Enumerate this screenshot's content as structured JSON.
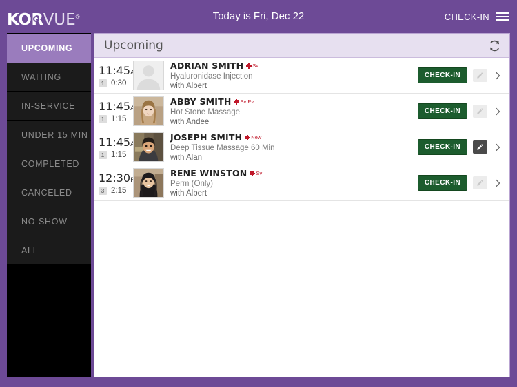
{
  "header": {
    "logo_main": "KOR",
    "logo_sub": "VUE",
    "logo_reg": "®",
    "today_text": "Today is Fri, Dec 22",
    "checkin_label": "CHECK-IN",
    "menu_icon": "hamburger-menu-icon"
  },
  "sidebar": {
    "items": [
      {
        "label": "UPCOMING",
        "active": true
      },
      {
        "label": "WAITING",
        "active": false
      },
      {
        "label": "IN-SERVICE",
        "active": false
      },
      {
        "label": "UNDER 15 MIN",
        "active": false
      },
      {
        "label": "COMPLETED",
        "active": false
      },
      {
        "label": "CANCELED",
        "active": false
      },
      {
        "label": "NO-SHOW",
        "active": false
      },
      {
        "label": "ALL",
        "active": false
      }
    ]
  },
  "content": {
    "title": "Upcoming",
    "refresh_icon": "refresh-icon",
    "appointments": [
      {
        "time": "11:45",
        "meridiem": "AM",
        "count": "1",
        "duration": "0:30",
        "name": "ADRIAN SMITH",
        "tags": "Sv",
        "service": "Hyaluronidase Injection",
        "provider": "with Albert",
        "checkin_label": "CHECK-IN",
        "edit_enabled": false,
        "avatar": "placeholder-silhouette"
      },
      {
        "time": "11:45",
        "meridiem": "AM",
        "count": "1",
        "duration": "1:15",
        "name": "ABBY SMITH",
        "tags": "Sv Pv",
        "service": "Hot Stone Massage",
        "provider": "with Andee",
        "checkin_label": "CHECK-IN",
        "edit_enabled": false,
        "avatar": "photo-woman-blonde"
      },
      {
        "time": "11:45",
        "meridiem": "AM",
        "count": "1",
        "duration": "1:15",
        "name": "JOSEPH SMITH",
        "tags": "New",
        "service": "Deep Tissue Massage 60 Min",
        "provider": "with Alan",
        "checkin_label": "CHECK-IN",
        "edit_enabled": true,
        "avatar": "photo-man-smiling"
      },
      {
        "time": "12:30",
        "meridiem": "PM",
        "count": "3",
        "duration": "2:15",
        "name": "RENE WINSTON",
        "tags": "Sv",
        "service": "Perm (Only)",
        "provider": "with Albert",
        "checkin_label": "CHECK-IN",
        "edit_enabled": false,
        "avatar": "photo-woman-dark-hair"
      }
    ]
  },
  "colors": {
    "brand_purple": "#6d4a96",
    "active_nav": "#9a7cbd",
    "panel_header": "#e7e0f0",
    "checkin_green": "#1c5c2e",
    "tag_red": "#c0182a",
    "sidebar_black": "#000000"
  }
}
